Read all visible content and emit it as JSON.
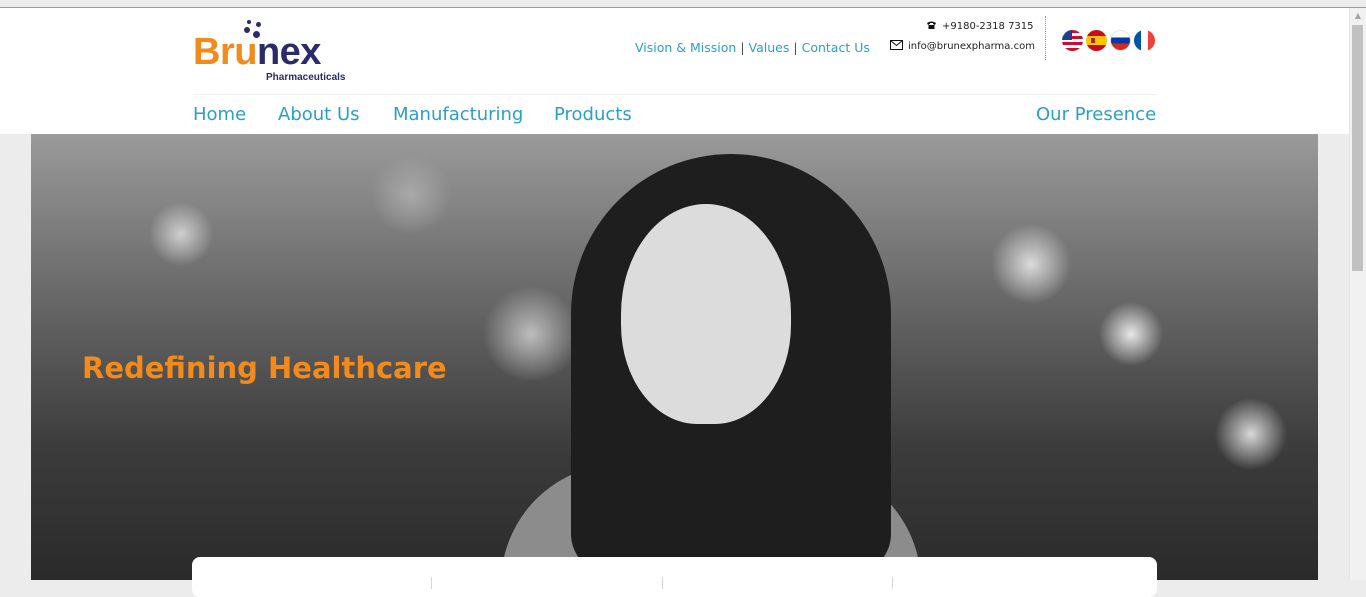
{
  "brand": {
    "name_part1": "Br",
    "name_part2": "u",
    "name_part3": "nex",
    "subtitle": "Pharmaceuticals",
    "primary_color": "#f28a1c",
    "secondary_color": "#2b2a6b"
  },
  "top_links": [
    {
      "label": "Vision & Mission"
    },
    {
      "label": "Values"
    },
    {
      "label": "Contact Us"
    }
  ],
  "top_links_separator": "|",
  "contact": {
    "phone_icon": "phone-icon",
    "phone": "+9180-2318 7315",
    "email_icon": "mail-icon",
    "email": "info@brunexpharma.com"
  },
  "languages": [
    {
      "icon": "us-flag-icon"
    },
    {
      "icon": "spain-flag-icon"
    },
    {
      "icon": "russia-flag-icon"
    },
    {
      "icon": "france-flag-icon"
    }
  ],
  "nav": {
    "items": [
      {
        "label": "Home"
      },
      {
        "label": "About Us"
      },
      {
        "label": "Manufacturing"
      },
      {
        "label": "Products"
      }
    ],
    "right_item": {
      "label": "Our Presence"
    },
    "link_color": "#2a9fc9"
  },
  "hero": {
    "title": "Redefining Healthcare"
  }
}
